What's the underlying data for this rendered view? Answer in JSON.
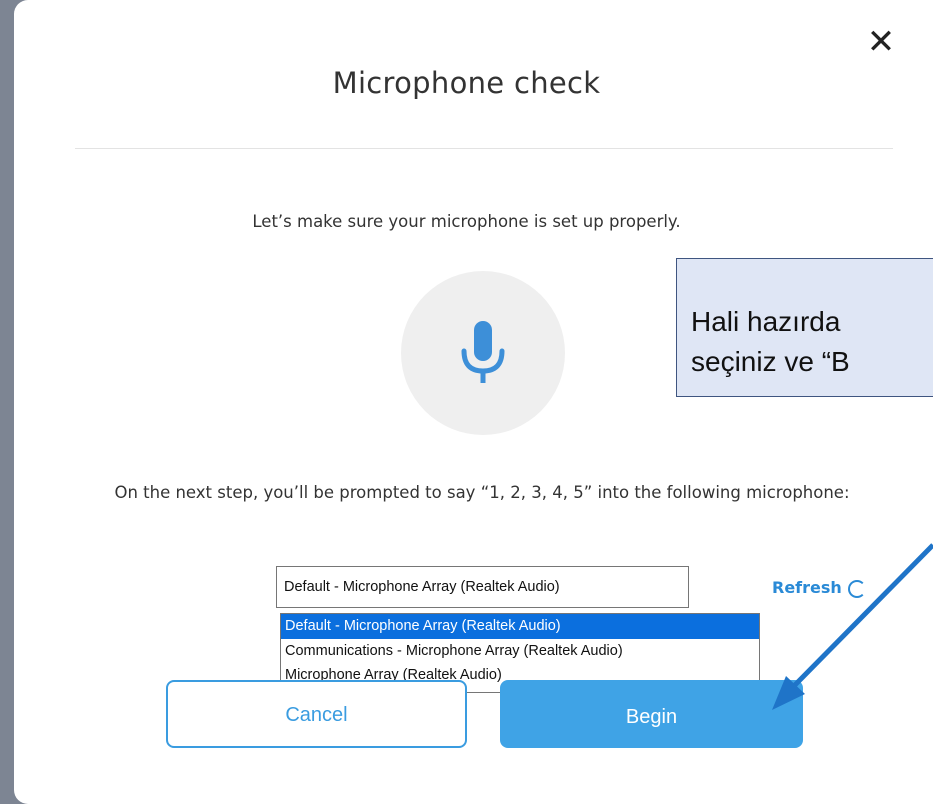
{
  "dialog": {
    "title": "Microphone check",
    "close_icon": "close-icon",
    "intro": "Let’s make sure your microphone is set up properly.",
    "mic_icon": "microphone-icon",
    "instructions": "On the next step, you’ll be prompted to say “1, 2, 3, 4, 5” into the following microphone:",
    "device_select": {
      "selected_value": "Default - Microphone Array (Realtek Audio)",
      "options": [
        "Default - Microphone Array (Realtek Audio)",
        "Communications - Microphone Array (Realtek Audio)",
        "Microphone Array (Realtek Audio)"
      ]
    },
    "refresh_label": "Refresh",
    "cancel_label": "Cancel",
    "begin_label": "Begin"
  },
  "callout": {
    "line1": "Hali hazırda",
    "line2": "seçiniz ve “B"
  },
  "colors": {
    "accent": "#3fa3e6",
    "link": "#2a8ad6",
    "highlight": "#0b6fde",
    "callout_bg": "#dfe6f5",
    "arrow": "#1f74c8"
  }
}
